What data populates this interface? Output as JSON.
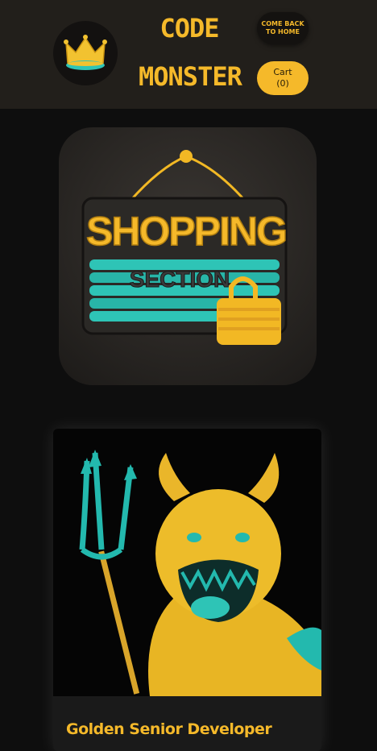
{
  "header": {
    "title_line1": "CODE",
    "title_line2": "MONSTER",
    "home_button": "COME BACK TO HOME",
    "cart_label": "Cart",
    "cart_count": "(0)"
  },
  "hero": {
    "sign_title": "SHOPPING",
    "sign_subtitle": "SECTION"
  },
  "product": {
    "title": "Golden Senior Developer"
  },
  "colors": {
    "accent": "#f5b92a",
    "teal": "#2ec4b6",
    "header_bg": "#221f1b",
    "page_bg": "#0e0e0e"
  },
  "icons": [
    "crown-icon",
    "padlock-icon"
  ]
}
